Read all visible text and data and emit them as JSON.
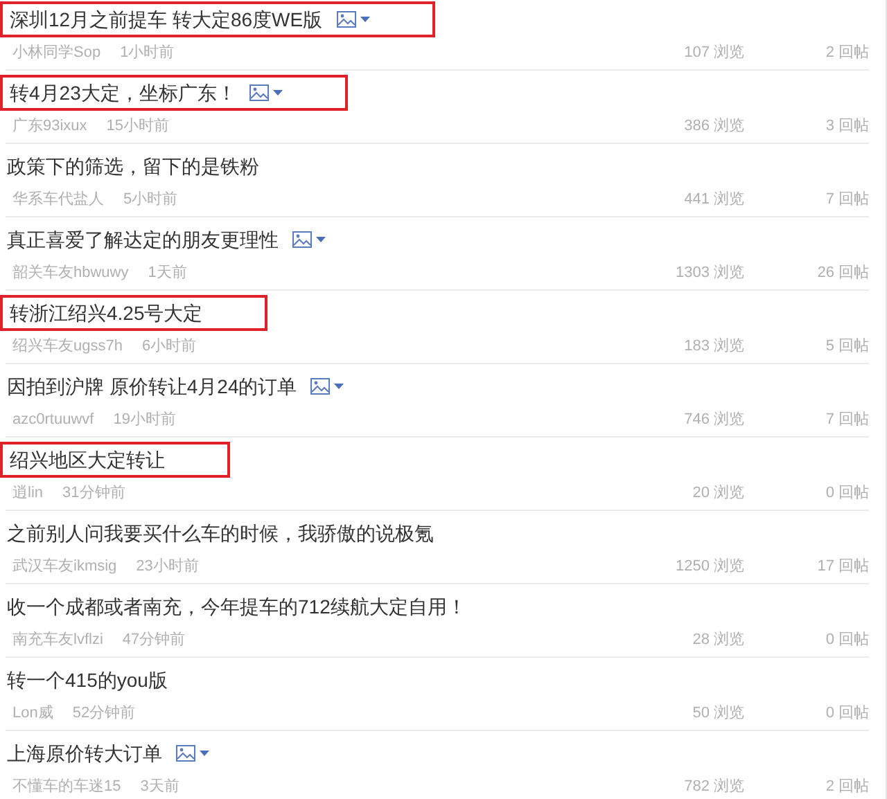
{
  "threads": [
    {
      "title": "深圳12月之前提车 转大定86度WE版",
      "has_image": true,
      "highlighted": true,
      "author": "小林同学Sop",
      "time": "1小时前",
      "views": "107 浏览",
      "replies": "2 回帖"
    },
    {
      "title": "转4月23大定，坐标广东！",
      "has_image": true,
      "highlighted": true,
      "author": "广东93ixux",
      "time": "15小时前",
      "views": "386 浏览",
      "replies": "3 回帖"
    },
    {
      "title": "政策下的筛选，留下的是铁粉",
      "has_image": false,
      "highlighted": false,
      "author": "华系车代盐人",
      "time": "5小时前",
      "views": "441 浏览",
      "replies": "7 回帖"
    },
    {
      "title": "真正喜爱了解达定的朋友更理性",
      "has_image": true,
      "highlighted": false,
      "author": "韶关车友hbwuwy",
      "time": "1天前",
      "views": "1303 浏览",
      "replies": "26 回帖"
    },
    {
      "title": "转浙江绍兴4.25号大定",
      "has_image": false,
      "highlighted": true,
      "author": "绍兴车友ugss7h",
      "time": "6小时前",
      "views": "183 浏览",
      "replies": "5 回帖"
    },
    {
      "title": "因拍到沪牌 原价转让4月24的订单",
      "has_image": true,
      "highlighted": false,
      "author": "azc0rtuuwvf",
      "time": "19小时前",
      "views": "746 浏览",
      "replies": "7 回帖"
    },
    {
      "title": "绍兴地区大定转让",
      "has_image": false,
      "highlighted": true,
      "author": "逍lin",
      "time": "31分钟前",
      "views": "20 浏览",
      "replies": "0 回帖"
    },
    {
      "title": "之前别人问我要买什么车的时候，我骄傲的说极氪",
      "has_image": false,
      "highlighted": false,
      "author": "武汉车友ikmsig",
      "time": "23小时前",
      "views": "1250 浏览",
      "replies": "17 回帖"
    },
    {
      "title": "收一个成都或者南充，今年提车的712续航大定自用！",
      "has_image": false,
      "highlighted": false,
      "author": "南充车友lvflzi",
      "time": "47分钟前",
      "views": "28 浏览",
      "replies": "0 回帖"
    },
    {
      "title": "转一个415的you版",
      "has_image": false,
      "highlighted": false,
      "author": "Lon威",
      "time": "52分钟前",
      "views": "50 浏览",
      "replies": "0 回帖"
    },
    {
      "title": "上海原价转大订单",
      "has_image": true,
      "highlighted": false,
      "author": "不懂车的车迷15",
      "time": "3天前",
      "views": "782 浏览",
      "replies": "2 回帖"
    }
  ]
}
